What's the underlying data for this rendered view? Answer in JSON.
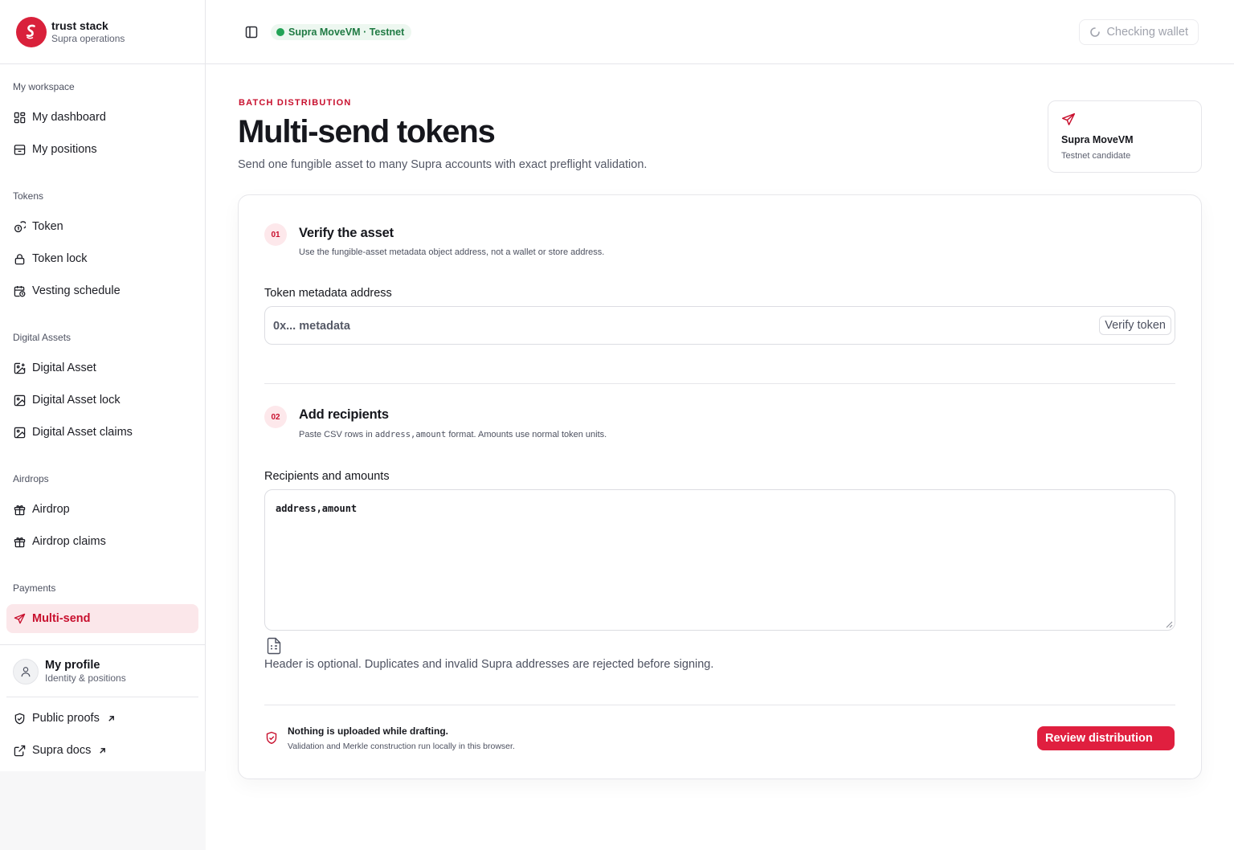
{
  "brand": {
    "name": "trust stack",
    "subtitle": "Supra operations"
  },
  "sidebar": {
    "sections": [
      {
        "title": "My workspace",
        "items": [
          {
            "label": "My dashboard",
            "icon": "dashboard-icon"
          },
          {
            "label": "My positions",
            "icon": "archive-icon"
          }
        ]
      },
      {
        "title": "Tokens",
        "items": [
          {
            "label": "Token",
            "icon": "coins-icon"
          },
          {
            "label": "Token lock",
            "icon": "lock-icon"
          },
          {
            "label": "Vesting schedule",
            "icon": "calendar-clock-icon"
          }
        ]
      },
      {
        "title": "Digital Assets",
        "items": [
          {
            "label": "Digital Asset",
            "icon": "image-plus-icon"
          },
          {
            "label": "Digital Asset lock",
            "icon": "image-icon"
          },
          {
            "label": "Digital Asset claims",
            "icon": "image-icon"
          }
        ]
      },
      {
        "title": "Airdrops",
        "items": [
          {
            "label": "Airdrop",
            "icon": "gift-icon"
          },
          {
            "label": "Airdrop claims",
            "icon": "gift-icon"
          }
        ]
      },
      {
        "title": "Payments",
        "items": [
          {
            "label": "Multi-send",
            "icon": "send-icon",
            "active": true
          }
        ]
      }
    ],
    "profile": {
      "name": "My profile",
      "subtitle": "Identity & positions"
    },
    "footer_links": [
      {
        "label": "Public proofs",
        "icon": "shield-icon"
      },
      {
        "label": "Supra docs",
        "icon": "external-link-icon"
      }
    ]
  },
  "header": {
    "network_badge": "Supra MoveVM · Testnet",
    "wallet_button": "Checking wallet"
  },
  "page": {
    "eyebrow": "BATCH DISTRIBUTION",
    "title": "Multi-send tokens",
    "description": "Send one fungible asset to many Supra accounts with exact preflight validation."
  },
  "network_card": {
    "title": "Supra MoveVM",
    "subtitle": "Testnet candidate"
  },
  "steps": {
    "verify": {
      "number": "01",
      "title": "Verify the asset",
      "description": "Use the fungible-asset metadata object address, not a wallet or store address.",
      "field_label": "Token metadata address",
      "placeholder": "0x... metadata",
      "button": "Verify token"
    },
    "recipients": {
      "number": "02",
      "title": "Add recipients",
      "desc_prefix": "Paste CSV rows in ",
      "desc_code": "address,amount",
      "desc_suffix": " format. Amounts use normal token units.",
      "field_label": "Recipients and amounts",
      "value": "address,amount",
      "hint": "Header is optional. Duplicates and invalid Supra addresses are rejected before signing."
    }
  },
  "footer_notice": {
    "title": "Nothing is uploaded while drafting.",
    "subtitle": "Validation and Merkle construction run locally in this browser."
  },
  "review_button": "Review distribution",
  "colors": {
    "accent": "#e01f3f",
    "brand": "#d9213b",
    "success": "#22a356"
  }
}
